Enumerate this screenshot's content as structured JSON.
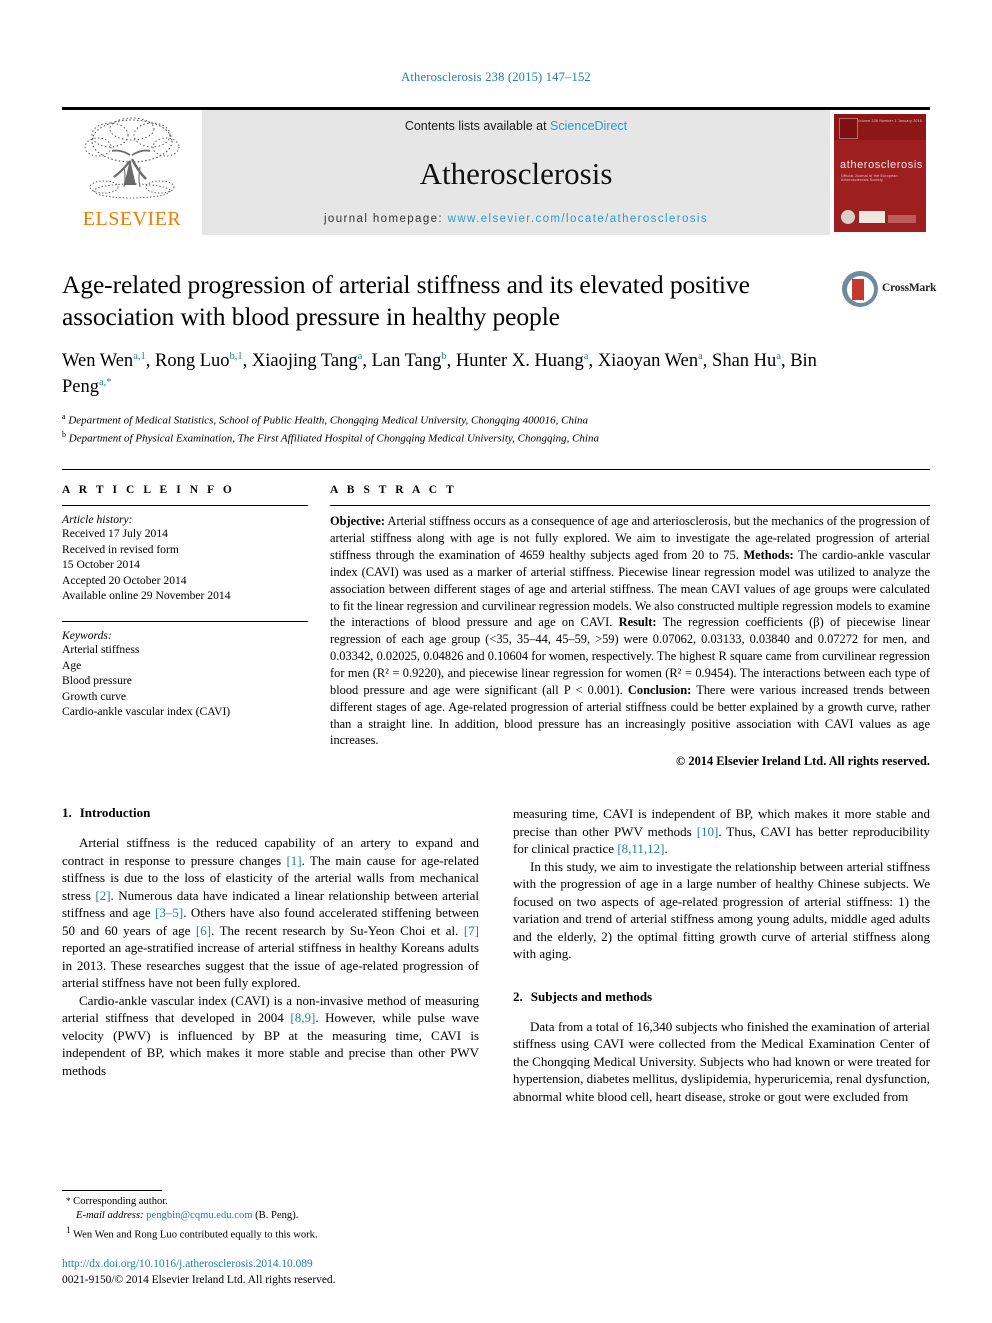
{
  "running_head": "Atherosclerosis 238 (2015) 147–152",
  "masthead": {
    "publisher": "ELSEVIER",
    "contents_prefix": "Contents lists available at ",
    "contents_link": "ScienceDirect",
    "journal_name": "Atherosclerosis",
    "homepage_prefix": "journal homepage: ",
    "homepage_url": "www.elsevier.com/locate/atherosclerosis",
    "cover": {
      "title": "atherosclerosis",
      "subtitle": "Official Journal of the European Atherosclerosis Society",
      "top_note": "Volume 238  Number 1  January 2015"
    }
  },
  "article": {
    "title": "Age-related progression of arterial stiffness and its elevated positive association with blood pressure in healthy people",
    "crossmark_label": "CrossMark",
    "authors": [
      {
        "name": "Wen Wen",
        "sup": "a,1",
        "sep": ", "
      },
      {
        "name": "Rong Luo",
        "sup": "b,1",
        "sep": ", "
      },
      {
        "name": "Xiaojing Tang",
        "sup": "a",
        "sep": ", "
      },
      {
        "name": "Lan Tang",
        "sup": "b",
        "sep": ", "
      },
      {
        "name": "Hunter X. Huang",
        "sup": "a",
        "sep": ", "
      },
      {
        "name": "Xiaoyan Wen",
        "sup": "a",
        "sep": ", "
      },
      {
        "name": "Shan Hu",
        "sup": "a",
        "sep": ", "
      },
      {
        "name": "Bin Peng",
        "sup": "a,*",
        "sep": ""
      }
    ],
    "affiliations": [
      {
        "mark": "a",
        "text": "Department of Medical Statistics, School of Public Health, Chongqing Medical University, Chongqing 400016, China"
      },
      {
        "mark": "b",
        "text": "Department of Physical Examination, The First Affiliated Hospital of Chongqing Medical University, Chongqing, China"
      }
    ]
  },
  "article_info": {
    "heading": "A R T I C L E   I N F O",
    "history_label": "Article history:",
    "history": [
      "Received 17 July 2014",
      "Received in revised form",
      "15 October 2014",
      "Accepted 20 October 2014",
      "Available online 29 November 2014"
    ],
    "keywords_label": "Keywords:",
    "keywords": [
      "Arterial stiffness",
      "Age",
      "Blood pressure",
      "Growth curve",
      "Cardio-ankle vascular index (CAVI)"
    ]
  },
  "abstract": {
    "heading": "A B S T R A C T",
    "objective_label": "Objective:",
    "objective_text": " Arterial stiffness occurs as a consequence of age and arteriosclerosis, but the mechanics of the progression of arterial stiffness along with age is not fully explored. We aim to investigate the age-related progression of arterial stiffness through the examination of 4659 healthy subjects aged from 20 to 75. ",
    "methods_label": "Methods:",
    "methods_text": " The cardio-ankle vascular index (CAVI) was used as a marker of arterial stiffness. Piecewise linear regression model was utilized to analyze the association between different stages of age and arterial stiffness. The mean CAVI values of age groups were calculated to fit the linear regression and curvilinear regression models. We also constructed multiple regression models to examine the interactions of blood pressure and age on CAVI. ",
    "result_label": "Result:",
    "result_text": " The regression coefficients (β) of piecewise linear regression of each age group (<35, 35–44, 45–59, >59) were 0.07062, 0.03133, 0.03840 and 0.07272 for men, and 0.03342, 0.02025, 0.04826 and 0.10604 for women, respectively. The highest R square came from curvilinear regression for men (R² = 0.9220), and piecewise linear regression for women (R² = 0.9454). The interactions between each type of blood pressure and age were significant (all P < 0.001). ",
    "conclusion_label": "Conclusion:",
    "conclusion_text": " There were various increased trends between different stages of age. Age-related progression of arterial stiffness could be better explained by a growth curve, rather than a straight line. In addition, blood pressure has an increasingly positive association with CAVI values as age increases.",
    "copyright": "© 2014 Elsevier Ireland Ltd. All rights reserved."
  },
  "sections": {
    "intro": {
      "number": "1.",
      "title": "Introduction",
      "p1_a": "Arterial stiffness is the reduced capability of an artery to expand and contract in response to pressure changes ",
      "p1_c1": "[1]",
      "p1_b": ". The main cause for age-related stiffness is due to the loss of elasticity of the arterial walls from mechanical stress ",
      "p1_c2": "[2]",
      "p1_c": ". Numerous data have indicated a linear relationship between arterial stiffness and age ",
      "p1_c3": "[3–5]",
      "p1_d": ". Others have also found accelerated stiffening between 50 and 60 years of age ",
      "p1_c4": "[6]",
      "p1_e": ". The recent research by Su-Yeon Choi et al. ",
      "p1_c5": "[7]",
      "p1_f": " reported an age-stratified increase of arterial stiffness in healthy Koreans adults in 2013. These researches suggest that the issue of age-related progression of arterial stiffness have not been fully explored.",
      "p2_a": "Cardio-ankle vascular index (CAVI) is a non-invasive method of measuring arterial stiffness that developed in 2004 ",
      "p2_c1": "[8,9]",
      "p2_b": ". However, while pulse wave velocity (PWV) is influenced by BP at the measuring time, CAVI is independent of BP, which makes it more stable and precise than other PWV methods ",
      "p2_c2": "[10]",
      "p2_c": ". Thus, CAVI has better reproducibility for clinical practice ",
      "p2_c3": "[8,11,12]",
      "p2_d": ".",
      "p3": "In this study, we aim to investigate the relationship between arterial stiffness with the progression of age in a large number of healthy Chinese subjects. We focused on two aspects of age-related progression of arterial stiffness: 1) the variation and trend of arterial stiffness among young adults, middle aged adults and the elderly, 2) the optimal fitting growth curve of arterial stiffness along with aging."
    },
    "methods": {
      "number": "2.",
      "title": "Subjects and methods",
      "p1": "Data from a total of 16,340 subjects who finished the examination of arterial stiffness using CAVI were collected from the Medical Examination Center of the Chongqing Medical University. Subjects who had known or were treated for hypertension, diabetes mellitus, dyslipidemia, hyperuricemia, renal dysfunction, abnormal white blood cell, heart disease, stroke or gout were excluded from"
    }
  },
  "footnotes": {
    "corresponding_mark": "*",
    "corresponding_text": "Corresponding author.",
    "email_label": "E-mail address:",
    "email": "pengbin@cqmu.edu.com",
    "email_suffix": " (B. Peng).",
    "equal_mark": "1",
    "equal_text": "Wen Wen and Rong Luo contributed equally to this work.",
    "doi": "http://dx.doi.org/10.1016/j.atherosclerosis.2014.10.089",
    "issn_line": "0021-9150/© 2014 Elsevier Ireland Ltd. All rights reserved."
  },
  "colors": {
    "link": "#1f7fa8",
    "sciencedirect": "#2e9bc7",
    "elsevier_orange": "#f07c00",
    "cover_red": "#9d1f1f"
  }
}
